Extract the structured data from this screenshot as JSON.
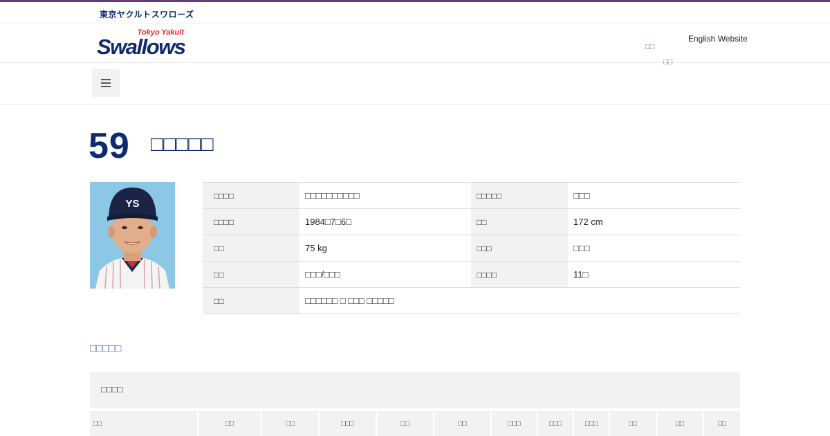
{
  "topbar": {
    "club_name": "東京ヤクルトスワローズ"
  },
  "header": {
    "logo_top": "Tokyo Yakult",
    "logo_main": "Swallows",
    "english_link": "English Website",
    "link_a": "□□",
    "link_b": "□□"
  },
  "colors": {
    "navy": "#0d2a6e",
    "accent_red": "#e8262d",
    "link_blue": "#3b64b8",
    "stripe": "#6b3a7d"
  },
  "player": {
    "number": "59",
    "name": "□□□□□",
    "photo_icon": "player-photo"
  },
  "profile": {
    "rows": [
      {
        "label1": "□□□□",
        "value1": "□□□□□□□□□□",
        "label2": "□□□□□",
        "value2": "□□□"
      },
      {
        "label1": "□□□□",
        "value1": "1984□7□6□",
        "label2": "□□",
        "value2": "172 cm"
      },
      {
        "label1": "□□",
        "value1": "75 kg",
        "label2": "□□□",
        "value2": "□□□"
      },
      {
        "label1": "□□",
        "value1": "□□□/□□□",
        "label2": "□□□□",
        "value2": "11□"
      },
      {
        "label1": "□□",
        "value1": "□□□□□□ □ □□□ □□□□□"
      }
    ]
  },
  "stats": {
    "section_title": "□□□□□",
    "table_title": "□□□□",
    "headers": [
      "□□",
      "□□",
      "□□",
      "□□□",
      "□□",
      "□□",
      "□□□",
      "□□□",
      "□□□",
      "□□",
      "□□",
      "□□"
    ]
  }
}
